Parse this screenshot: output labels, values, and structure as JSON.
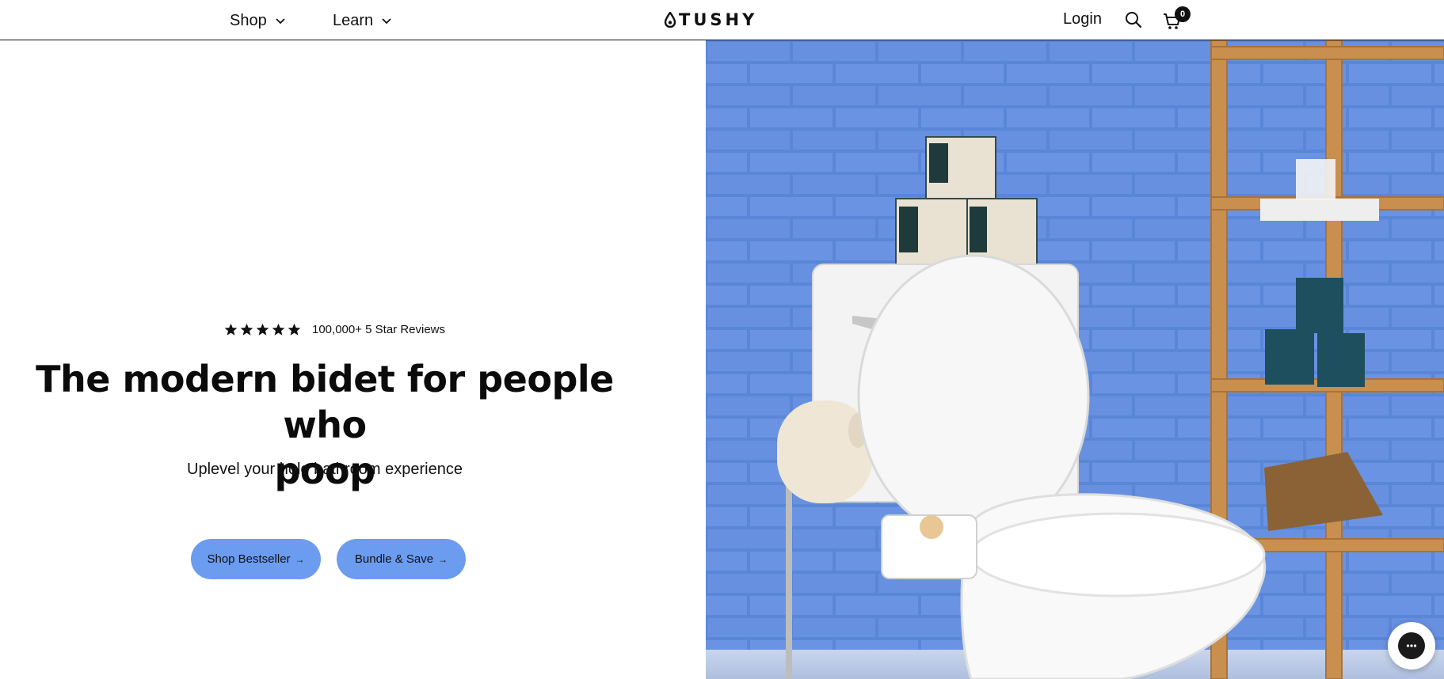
{
  "header": {
    "nav": [
      {
        "label": "Shop"
      },
      {
        "label": "Learn"
      }
    ],
    "logo_text": "TUSHY",
    "login_label": "Login",
    "cart_count": "0"
  },
  "hero": {
    "rating_stars": 5,
    "rating_text": "100,000+ 5 Star Reviews",
    "headline_line1": "The modern bidet for people who",
    "headline_line2": "poop",
    "subhead": "Uplevel your hole bathroom experience",
    "buttons": [
      {
        "label": "Shop Bestseller",
        "arrow": "→"
      },
      {
        "label": "Bundle & Save",
        "arrow": "→"
      }
    ],
    "accent_color": "#6b9cf0"
  },
  "icons": [
    "chevron-down-icon",
    "logo-drop-icon",
    "search-icon",
    "cart-icon",
    "star-icon",
    "arrow-right-icon",
    "chat-icon"
  ]
}
